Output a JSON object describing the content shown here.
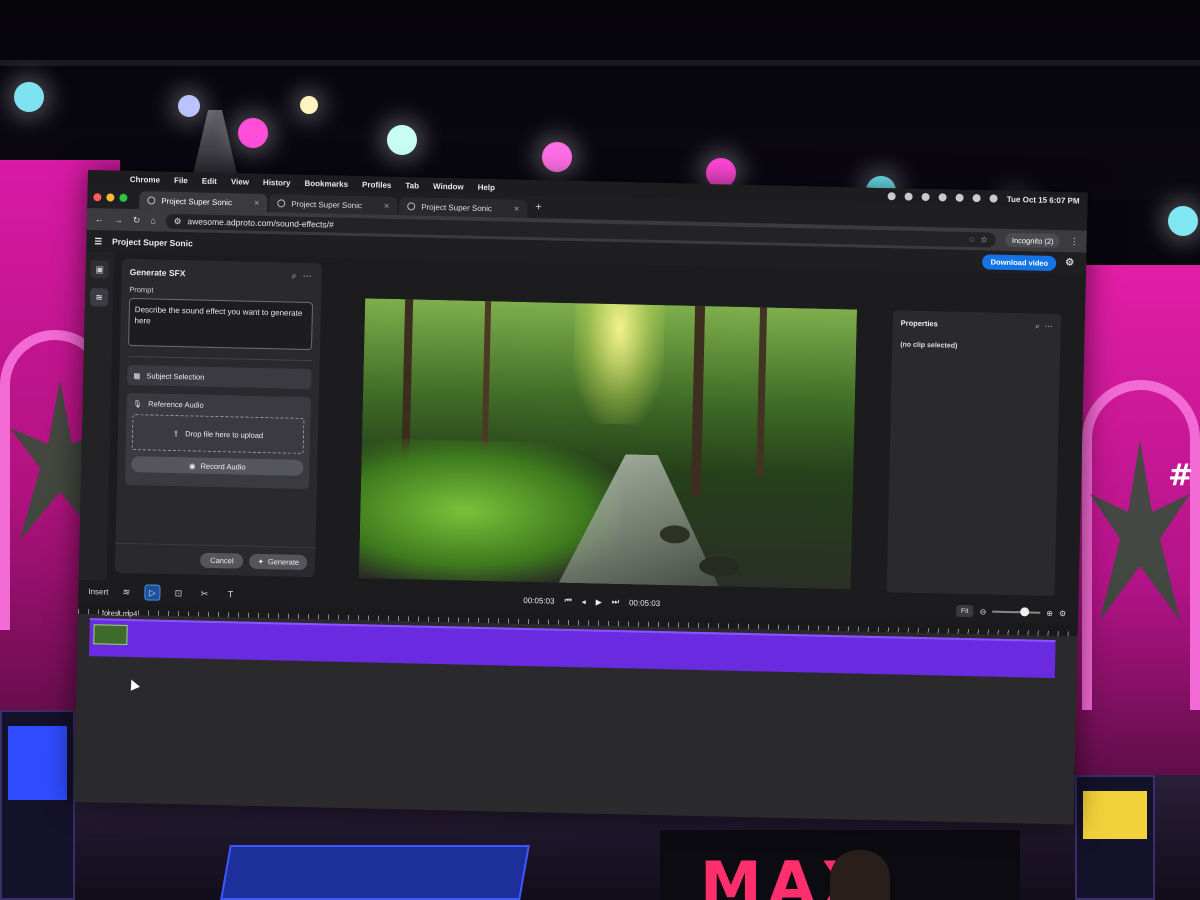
{
  "os_menubar": {
    "app": "Chrome",
    "items": [
      "File",
      "Edit",
      "View",
      "History",
      "Bookmarks",
      "Profiles",
      "Tab",
      "Window",
      "Help"
    ],
    "clock": "Tue Oct 15  6:07 PM"
  },
  "browser": {
    "tabs": [
      {
        "title": "Project Super Sonic",
        "active": true
      },
      {
        "title": "Project Super Sonic",
        "active": false
      },
      {
        "title": "Project Super Sonic",
        "active": false
      }
    ],
    "new_tab": "+",
    "url": "awesome.adproto.com/sound-effects/#",
    "incognito_label": "Incognito (2)"
  },
  "app": {
    "title": "Project Super Sonic",
    "download_label": "Download video"
  },
  "generate_panel": {
    "title": "Generate SFX",
    "prompt_label": "Prompt",
    "prompt_placeholder": "Describe the sound effect you want to generate here",
    "subject_selection": "Subject Selection",
    "reference_audio": "Reference Audio",
    "drop_text": "Drop file here to upload",
    "record_label": "Record Audio",
    "cancel_label": "Cancel",
    "generate_label": "Generate"
  },
  "properties": {
    "title": "Properties",
    "empty_text": "(no clip selected)"
  },
  "timeline": {
    "insert_label": "Insert",
    "current_time": "00:05:03",
    "total_time": "00:05:03",
    "fit_label": "Fit",
    "clip_name": "forest.mp4"
  },
  "colors": {
    "accent_blue": "#1473e6",
    "clip_purple": "#6a2be0"
  }
}
